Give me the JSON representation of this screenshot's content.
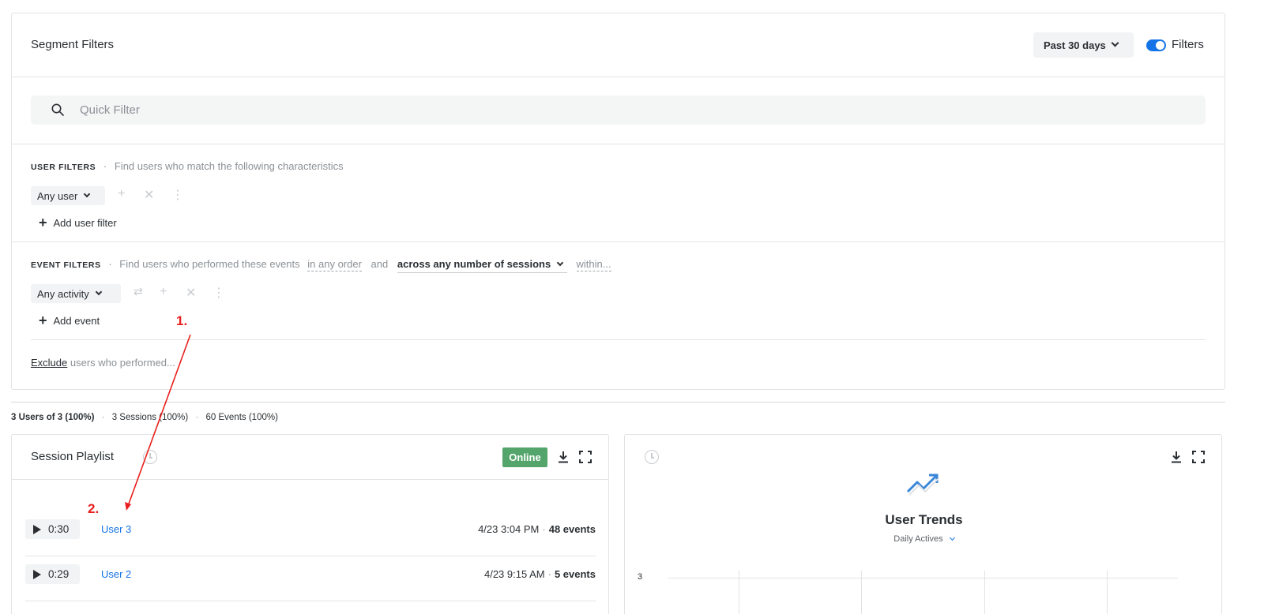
{
  "segment_filters": {
    "title": "Segment Filters",
    "date_range": "Past 30 days",
    "filters_toggle_label": "Filters",
    "filters_toggle_on": true
  },
  "quick_filter": {
    "placeholder": "Quick Filter"
  },
  "user_filters": {
    "heading": "USER FILTERS",
    "separator": "·",
    "description": "Find users who match the following characteristics",
    "selector": "Any user",
    "add_label": "Add user filter"
  },
  "event_filters": {
    "heading": "EVENT FILTERS",
    "separator": "·",
    "description": "Find users who performed these events",
    "order": "in any order",
    "and": "and",
    "sessions": "across any number of sessions",
    "within": "within...",
    "selector": "Any activity",
    "add_label": "Add event",
    "exclude_link": "Exclude",
    "exclude_rest": "users who performed..."
  },
  "stats": {
    "users": "3 Users of 3 (100%)",
    "sessions": "3 Sessions (100%)",
    "events": "60 Events (100%)",
    "separator": "·"
  },
  "session_playlist": {
    "title": "Session Playlist",
    "status": "Online",
    "rows": [
      {
        "duration": "0:30",
        "user": "User 3",
        "when": "4/23 3:04 PM",
        "events": "48 events"
      },
      {
        "duration": "0:29",
        "user": "User 2",
        "when": "4/23 9:15 AM",
        "events": "5 events"
      }
    ]
  },
  "user_trends": {
    "title": "User Trends",
    "metric": "Daily Actives",
    "y_tick": "3"
  },
  "annotations": {
    "step1": "1.",
    "step2": "2.",
    "color": "#e8201f"
  },
  "colors": {
    "accent": "#1473e6",
    "online": "#54a56c"
  }
}
